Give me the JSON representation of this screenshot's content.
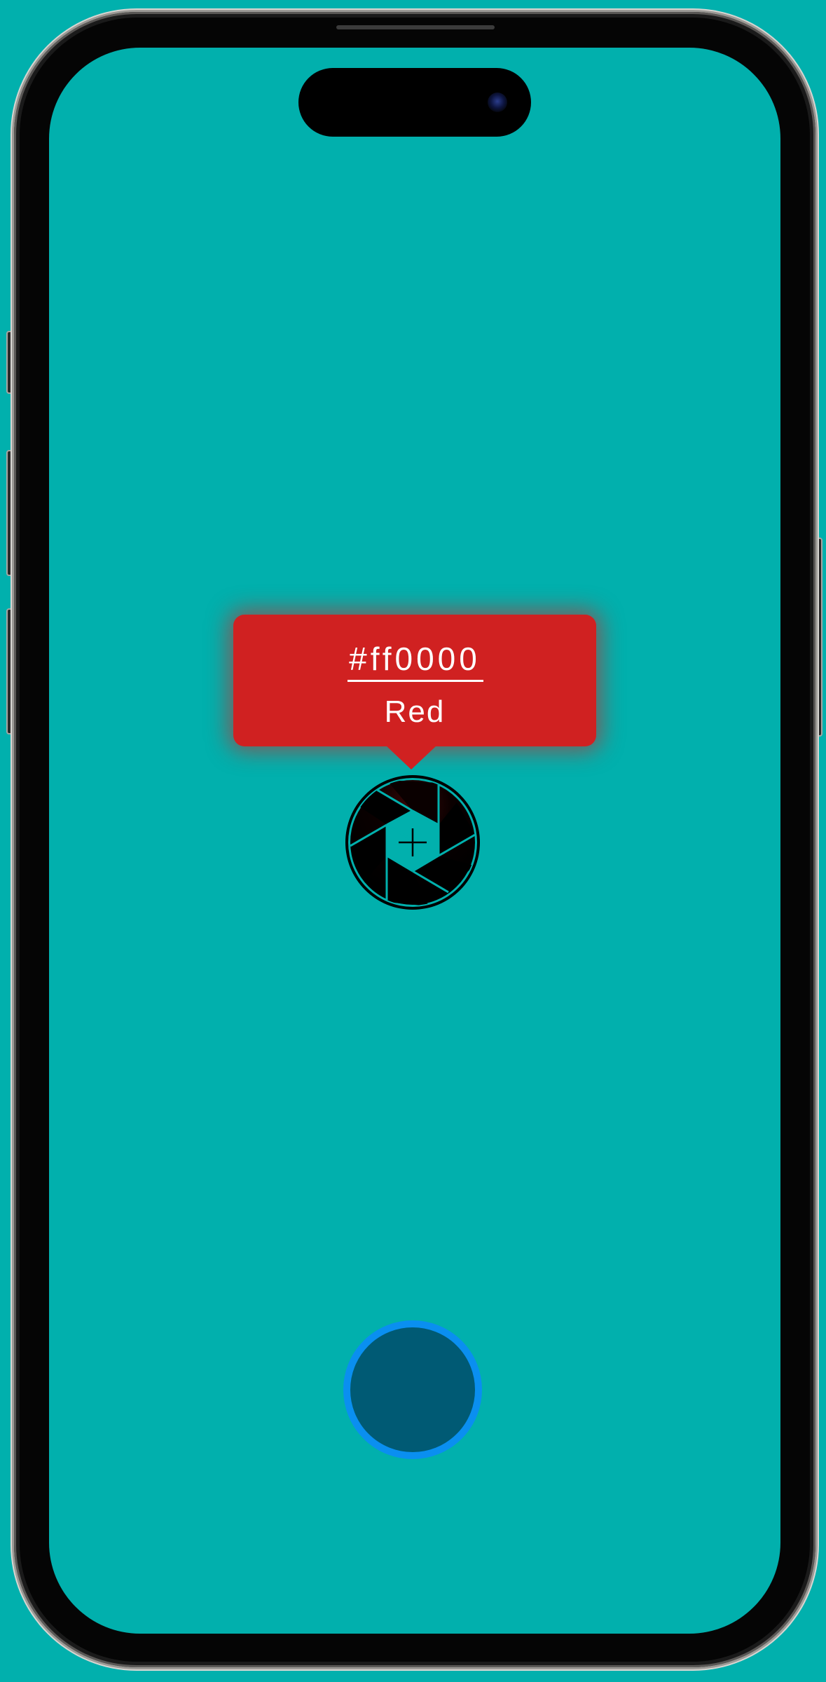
{
  "colors": {
    "background": "#01b0ad",
    "tooltip": "#d02121",
    "capture_fill": "#005a74",
    "capture_ring": "#0a8ff0"
  },
  "color_picker": {
    "hex_value": "#ff0000",
    "color_name": "Red"
  },
  "icons": {
    "loupe": "camera-aperture-crosshair-icon",
    "capture": "capture-button"
  }
}
